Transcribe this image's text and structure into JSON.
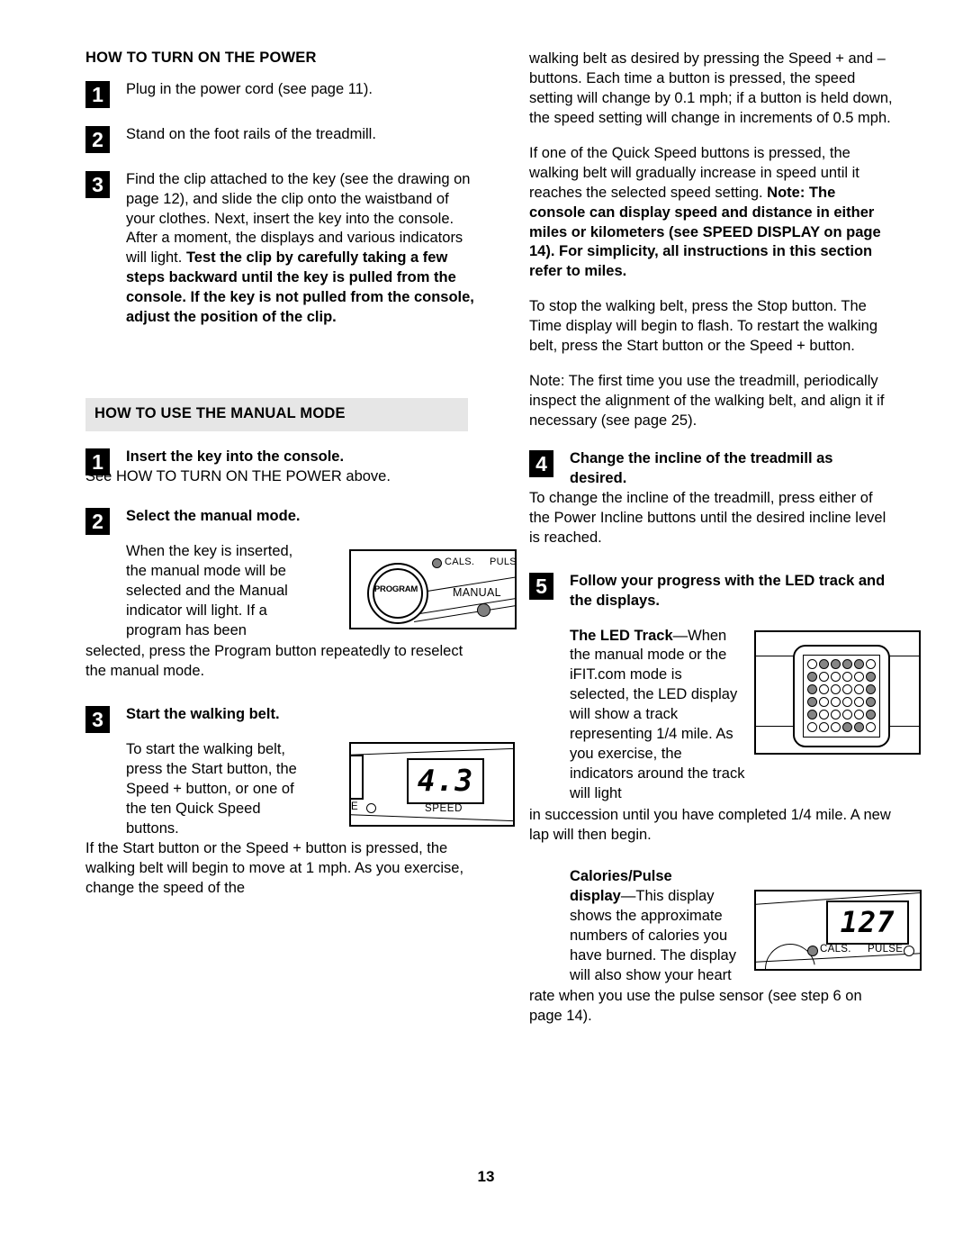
{
  "page": {
    "number": "13"
  },
  "left_column": {
    "section1": {
      "heading": "HOW TO TURN ON THE POWER",
      "steps": [
        {
          "number": "1",
          "text": "Plug in the power cord (see page 11)."
        },
        {
          "number": "2",
          "text": "Stand on the foot rails of the treadmill."
        },
        {
          "number": "3",
          "text_normal_1": "Find the clip attached to the key (see the drawing on page 12), and slide the clip onto the waistband of your clothes. Next, insert the key into the console. After a moment, the displays and various indicators will light. ",
          "text_bold": "Test the clip by carefully taking a few steps backward until the key is pulled from the console. If the key is not pulled from the console, adjust the position of the clip."
        }
      ]
    },
    "section2": {
      "heading": "HOW TO USE THE MANUAL MODE",
      "step1": {
        "number": "1",
        "title": "Insert the key into the console.",
        "body": "See HOW TO TURN ON THE POWER above."
      },
      "step2": {
        "number": "2",
        "title": "Select the manual mode.",
        "body_wrap": "When the key is inserted, the manual mode will be selected and the Manual indicator will light. If a program has been",
        "body_full": "selected, press the Program button repeatedly to reselect the manual mode."
      },
      "step3": {
        "number": "3",
        "title": "Start the walking belt.",
        "body_wrap": "To start the walking belt, press the Start button, the Speed + button, or one of the ten Quick Speed buttons.",
        "body_full": "If the Start button or the Speed + button is pressed, the walking belt will begin to move at 1 mph. As you exercise, change the speed of the"
      }
    }
  },
  "right_column": {
    "para1": "walking belt as desired by pressing the Speed + and – buttons. Each time a button is pressed, the speed setting will change by 0.1 mph; if a button is held down, the speed setting will change in increments of 0.5 mph.",
    "para2_normal": "If one of the Quick Speed buttons is pressed, the walking belt will gradually increase in speed until it reaches the selected speed setting. ",
    "para2_bold": "Note: The console can display speed and distance in either miles or kilometers (see SPEED DISPLAY on page 14). For simplicity, all instructions in this section refer to miles.",
    "para3": "To stop the walking belt, press the Stop button. The Time display will begin to flash. To restart the walking belt, press the Start button or the Speed + button.",
    "para4": "Note: The first time you use the treadmill, periodically inspect the alignment of the walking belt, and align it if necessary (see page 25).",
    "step4": {
      "number": "4",
      "title": "Change the incline of the treadmill as desired.",
      "body": "To change the incline of the treadmill, press either of the Power Incline buttons until the desired incline level is reached."
    },
    "step5": {
      "number": "5",
      "title": "Follow your progress with the LED track and the displays.",
      "led_track_bold": "The LED Track",
      "led_track_dash": "—When",
      "led_track_wrap": " the manual mode or the iFIT.com mode is selected, the LED display will show a track representing 1/4 mile. As you exercise, the indicators around the track will light",
      "led_track_full": "in succession until you have completed 1/4 mile. A new lap will then begin.",
      "calories_bold_1": "Calories/Pulse",
      "calories_bold_2": "display",
      "calories_dash": "—This display",
      "calories_wrap": " shows the approximate numbers of calories you have burned. The display will also show your heart",
      "calories_full": "rate when you use the pulse sensor (see step 6 on page 14)."
    }
  },
  "figures": {
    "program_console": {
      "name": "program-manual-console-figure",
      "knob_label": "PROGRAM",
      "cals_label": "CALS.",
      "pulse_label": "PULSE",
      "manual_label": "MANUAL"
    },
    "speed_display": {
      "name": "speed-display-figure",
      "value": "4.3",
      "label": "SPEED",
      "edge_label": "E"
    },
    "led_track": {
      "name": "led-track-figure",
      "rows": 6,
      "cols": 6,
      "pattern": [
        [
          0,
          1,
          1,
          1,
          1,
          0
        ],
        [
          1,
          0,
          0,
          0,
          0,
          1
        ],
        [
          1,
          0,
          0,
          0,
          0,
          1
        ],
        [
          1,
          0,
          0,
          0,
          0,
          1
        ],
        [
          1,
          0,
          0,
          0,
          0,
          1
        ],
        [
          0,
          0,
          0,
          1,
          1,
          0
        ]
      ]
    },
    "calories_display": {
      "name": "calories-pulse-display-figure",
      "value": "127",
      "cals_label": "CALS.",
      "pulse_label": "PULSE"
    }
  },
  "colors": {
    "heading_bar_bg": "#e6e6e6",
    "step_badge_bg": "#000000",
    "indicator_on": "#808080",
    "text": "#000000"
  }
}
